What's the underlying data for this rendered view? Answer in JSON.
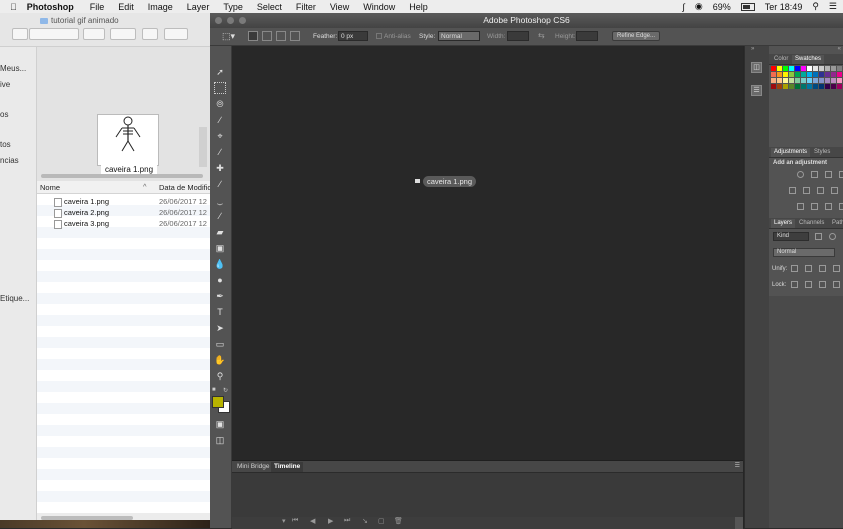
{
  "menubar": {
    "app": "Photoshop",
    "items": [
      "File",
      "Edit",
      "Image",
      "Layer",
      "Type",
      "Select",
      "Filter",
      "View",
      "Window",
      "Help"
    ],
    "battery": "69%",
    "clock": "Ter 18:49"
  },
  "finder": {
    "title": "tutorial gif animado",
    "sidebar": [
      "Meus...",
      "ive",
      "os",
      "tos",
      "ncias",
      "Etique..."
    ],
    "thumbnail_label": "caveira 1.png",
    "columns": {
      "name": "Nome",
      "date": "Data de Modific"
    },
    "files": [
      {
        "name": "caveira 1.png",
        "date": "26/06/2017 12"
      },
      {
        "name": "caveira 2.png",
        "date": "26/06/2017 12"
      },
      {
        "name": "caveira 3.png",
        "date": "26/06/2017 12"
      }
    ]
  },
  "photoshop": {
    "title": "Adobe Photoshop CS6",
    "options": {
      "feather_label": "Feather:",
      "feather_value": "0 px",
      "antialias": "Anti-alias",
      "style_label": "Style:",
      "style_value": "Normal",
      "width_label": "Width:",
      "height_label": "Height:",
      "refine_edge": "Refine Edge..."
    },
    "canvas_layer": "caveira 1.png",
    "timeline_tabs": [
      "Mini Bridge",
      "Timeline"
    ],
    "panels": {
      "color_tabs": [
        "Color",
        "Swatches"
      ],
      "adjust_tabs": [
        "Adjustments",
        "Styles"
      ],
      "add_adjustment": "Add an adjustment",
      "layer_tabs": [
        "Layers",
        "Channels",
        "Paths"
      ],
      "kind": "Kind",
      "blend": "Normal",
      "unify": "Unify:",
      "lock": "Lock:"
    },
    "foreground_color": "#b8b400",
    "background_color": "#ffffff"
  }
}
